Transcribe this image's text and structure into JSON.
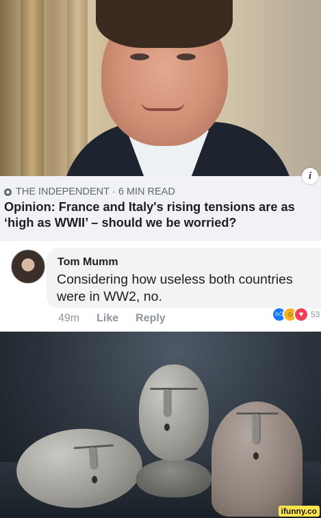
{
  "article": {
    "source": "THE INDEPENDENT",
    "separator": "·",
    "read_time": "6 MIN READ",
    "headline": "Opinion: France and Italy's rising tensions are as ‘high as WWII’ – should we be worried?",
    "info_icon_glyph": "i"
  },
  "comment": {
    "author": "Tom Mumm",
    "text": "Considering how useless both countries were in WW2, no.",
    "time": "49m",
    "like_label": "Like",
    "reply_label": "Reply",
    "reaction_count": "53",
    "reactions": [
      "like-icon",
      "haha-icon",
      "love-icon"
    ]
  },
  "watermark": "ifunny.co",
  "colors": {
    "meta_grey": "#606770",
    "text_dark": "#1c1e21",
    "bubble_bg": "#f2f3f5",
    "like_blue": "#1877f2",
    "love_red": "#f33e58",
    "haha_yellow": "#f7b125"
  }
}
